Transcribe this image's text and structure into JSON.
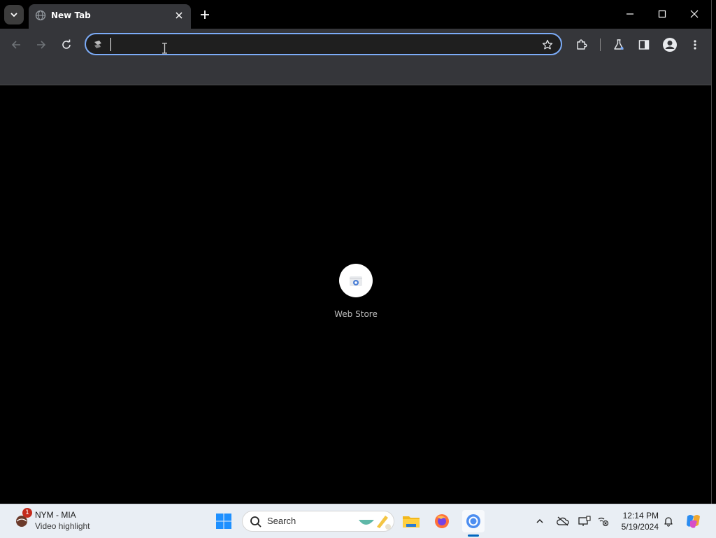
{
  "browser": {
    "tab": {
      "title": "New Tab"
    },
    "omnibox": {
      "value": "",
      "placeholder": ""
    },
    "shortcuts": [
      {
        "label": "Web Store"
      }
    ]
  },
  "taskbar": {
    "weather": {
      "badge": "1",
      "line1": "NYM - MIA",
      "line2": "Video highlight"
    },
    "search": {
      "label": "Search"
    },
    "clock": {
      "time": "12:14 PM",
      "date": "5/19/2024"
    }
  },
  "icons": {
    "tab_search": "chevron-down-icon",
    "favicon": "globe-icon",
    "tab_close": "close-icon",
    "new_tab": "plus-icon",
    "minimize": "minimize-icon",
    "maximize": "maximize-icon",
    "close_window": "close-icon",
    "back": "arrow-left-icon",
    "forward": "arrow-right-icon",
    "reload": "reload-icon",
    "bookmark": "star-icon",
    "extensions": "puzzle-icon",
    "labs": "flask-icon",
    "side_panel": "side-panel-icon",
    "profile": "profile-icon",
    "menu": "kebab-menu-icon"
  },
  "colors": {
    "accent": "#7cacf8",
    "toolbar": "#35363a",
    "taskbar": "#e9eef4"
  }
}
